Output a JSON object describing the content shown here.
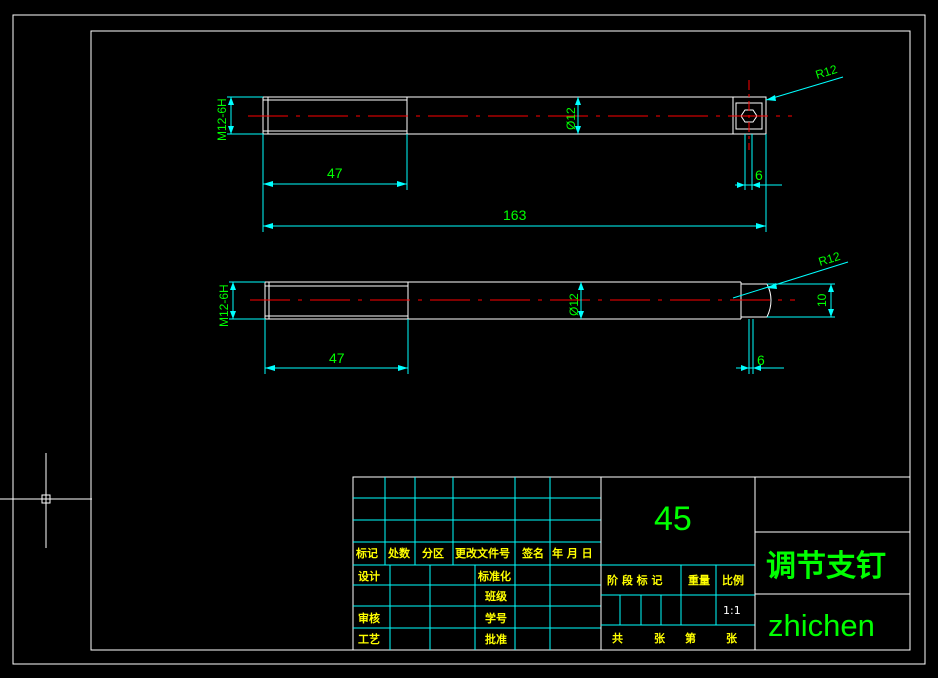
{
  "colors": {
    "background": "#000000",
    "outline": "#ffffff",
    "centerline": "#ff0000",
    "dimension": "#00ffff",
    "dimension_text": "#00ff00",
    "title_text": "#ffff00"
  },
  "part1": {
    "thread_label": "M12-6H",
    "diameter_label": "Ø12",
    "thread_length": "47",
    "total_length": "163",
    "radius_label": "R12",
    "slot_width": "6"
  },
  "part2": {
    "thread_label": "M12-6H",
    "diameter_label": "Ø12",
    "thread_length": "47",
    "radius_label": "R12",
    "flat_height": "10",
    "slot_width": "6"
  },
  "title_block": {
    "material": "45",
    "part_name": "调节支钉",
    "author": "zhichen",
    "scale": "1:1",
    "labels": {
      "mark": "标记",
      "count": "处数",
      "zone": "分区",
      "change_doc": "更改文件号",
      "sign": "签名",
      "date": "年 月 日",
      "design": "设计",
      "standardize": "标准化",
      "class": "班级",
      "review": "审核",
      "student_no": "学号",
      "process": "工艺",
      "approve": "批准",
      "stage_mark": "阶 段 标 记",
      "weight": "重量",
      "ratio": "比例",
      "total": "共",
      "sheets": "张",
      "sheet_no": "第",
      "sheet": "张"
    }
  }
}
